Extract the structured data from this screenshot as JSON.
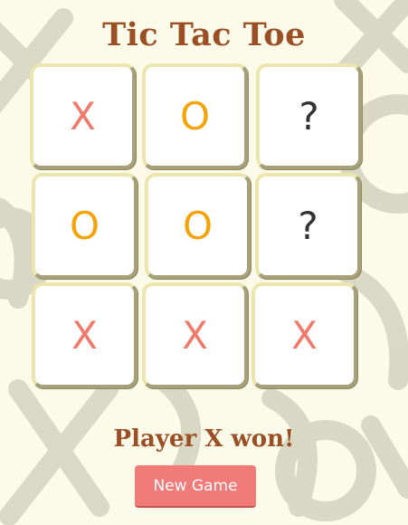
{
  "app": {
    "title": "Tic Tac Toe"
  },
  "board": {
    "cells": [
      {
        "mark": "X",
        "kind": "x"
      },
      {
        "mark": "O",
        "kind": "o"
      },
      {
        "mark": "?",
        "kind": "q"
      },
      {
        "mark": "O",
        "kind": "o"
      },
      {
        "mark": "O",
        "kind": "o"
      },
      {
        "mark": "?",
        "kind": "q"
      },
      {
        "mark": "X",
        "kind": "x"
      },
      {
        "mark": "X",
        "kind": "x"
      },
      {
        "mark": "X",
        "kind": "x"
      }
    ]
  },
  "status": {
    "message": "Player X won!"
  },
  "controls": {
    "new_game_label": "New Game"
  },
  "colors": {
    "background": "#fcfbe9",
    "title": "#9a4f25",
    "x_mark": "#f07b6c",
    "o_mark": "#f5a30b",
    "button": "#f07b78"
  }
}
